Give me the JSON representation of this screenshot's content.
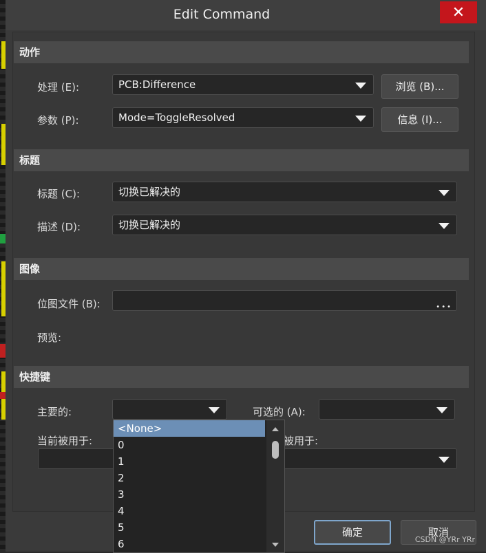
{
  "window": {
    "title": "Edit Command",
    "close_glyph": "✕"
  },
  "sections": {
    "action": "动作",
    "caption": "标题",
    "image": "图像",
    "shortcut": "快捷键"
  },
  "action": {
    "process_label": "处理 (E):",
    "process_value": "PCB:Difference",
    "browse_button": "浏览 (B)...",
    "params_label": "参数 (P):",
    "params_value": "Mode=ToggleResolved",
    "info_button": "信息 (I)..."
  },
  "caption": {
    "title_label": "标题 (C):",
    "title_value": "切换已解决的",
    "desc_label": "描述 (D):",
    "desc_value": "切换已解决的"
  },
  "image": {
    "bitmap_label": "位图文件 (B):",
    "bitmap_value": "",
    "bitmap_browse": "•••",
    "preview_label": "预览:"
  },
  "shortcut": {
    "primary_label": "主要的:",
    "primary_value": "",
    "alternate_label": "可选的 (A):",
    "alternate_value": "",
    "currently_used_label": "当前被用于:",
    "currently_used_label_right": "被用于:",
    "dropdown_options": [
      "<None>",
      "0",
      "1",
      "2",
      "3",
      "4",
      "5",
      "6"
    ],
    "selected_option": "<None>"
  },
  "footer": {
    "ok_button": "确定",
    "cancel_button": "取消"
  },
  "watermark": "CSDN @YRr YRr",
  "colors": {
    "close_red": "#c4161c",
    "selection_blue": "#6c8fb6",
    "ok_border": "#7fa6cc"
  }
}
